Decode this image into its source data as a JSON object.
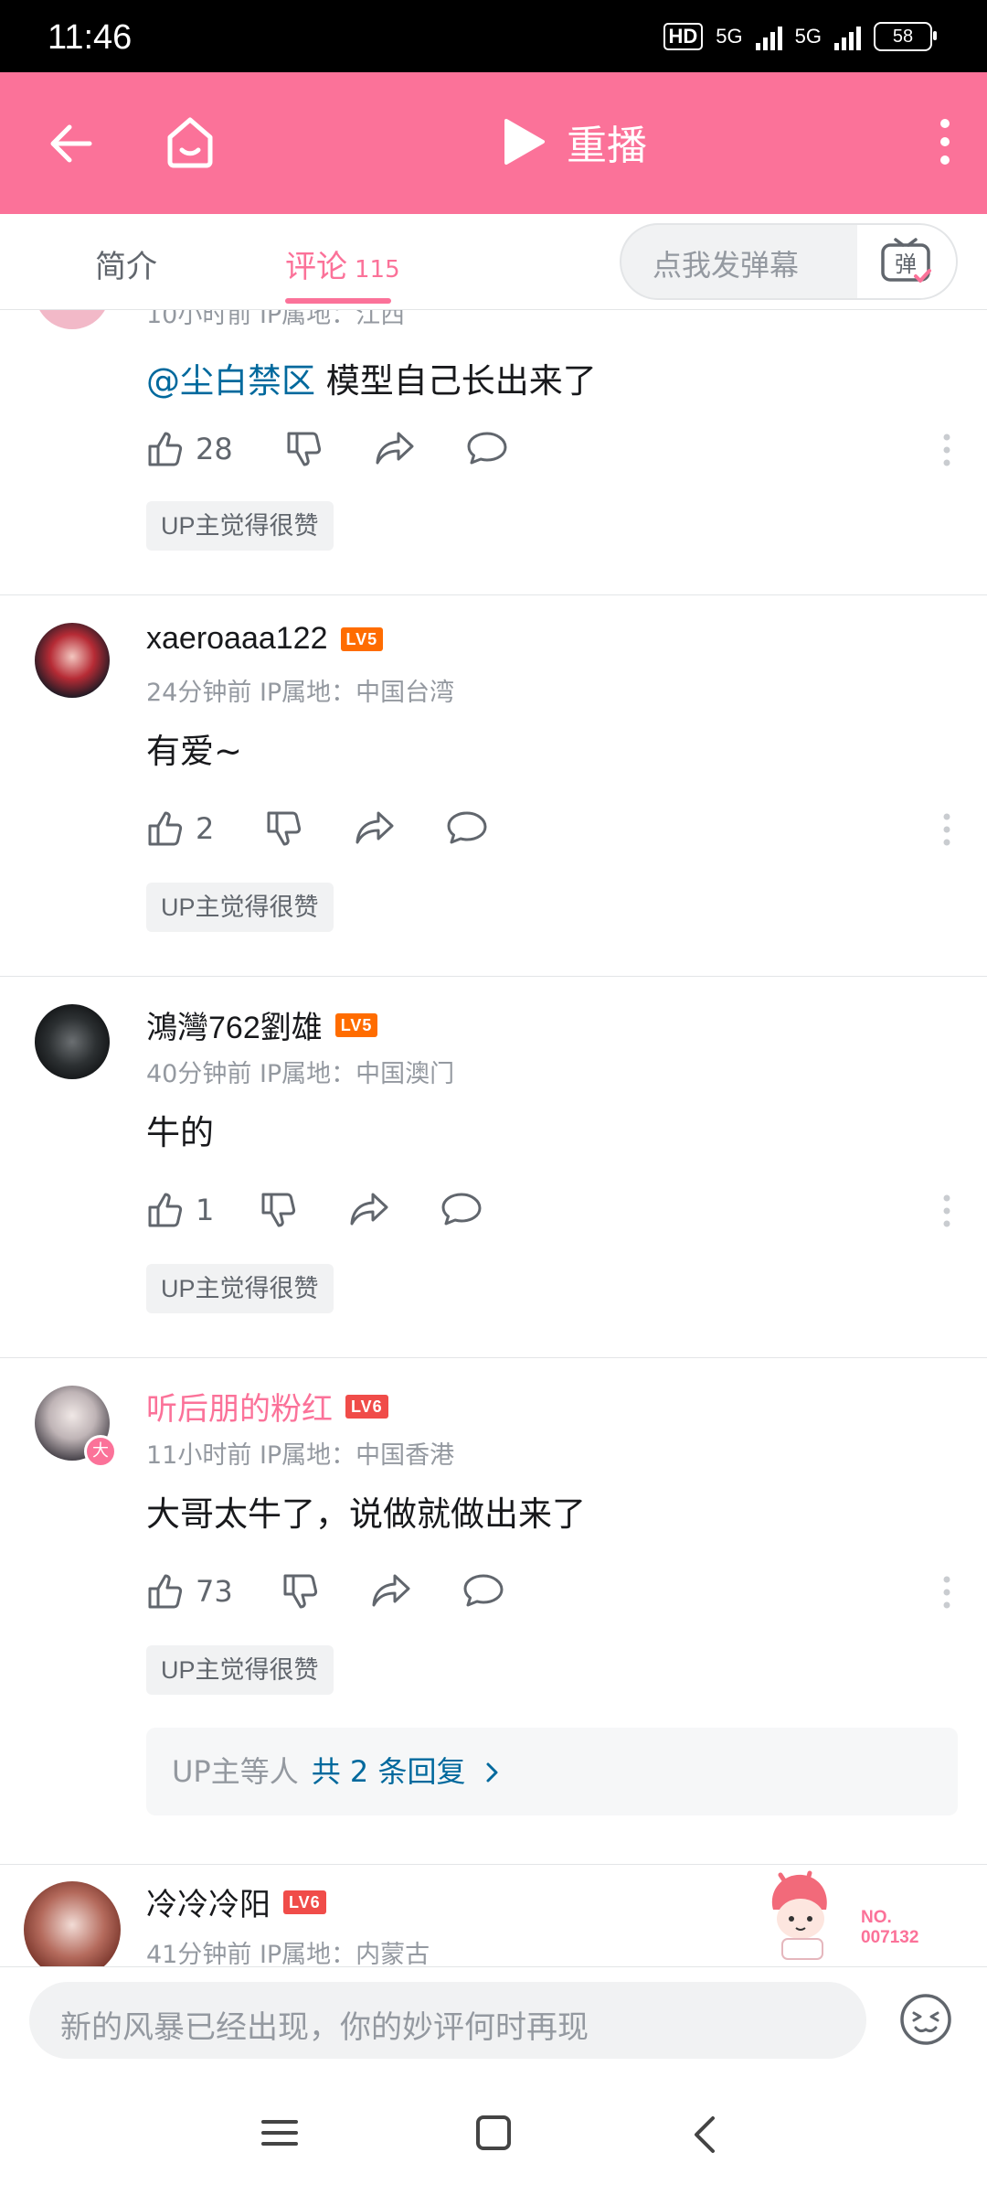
{
  "status_bar": {
    "time": "11:46",
    "hd": "HD",
    "net1": "5G",
    "net2": "5G",
    "battery": "58"
  },
  "topbar": {
    "replay_label": "重播"
  },
  "tabs": {
    "intro": "简介",
    "comments": "评论",
    "comments_count": "115",
    "danmu_placeholder": "点我发弹幕",
    "danmu_icon_char": "弹"
  },
  "comments": [
    {
      "meta": "10小时前 IP属地：江西",
      "mention": "@尘白禁区",
      "text": "模型自己长出来了",
      "likes": "28",
      "up_badge": "UP主觉得很赞"
    },
    {
      "username": "xaeroaaa122",
      "level": "LV5",
      "meta": "24分钟前 IP属地：中国台湾",
      "text": "有爱~",
      "likes": "2",
      "up_badge": "UP主觉得很赞"
    },
    {
      "username": "鴻灣762劉雄",
      "level": "LV5",
      "meta": "40分钟前 IP属地：中国澳门",
      "text": "牛的",
      "likes": "1",
      "up_badge": "UP主觉得很赞"
    },
    {
      "username": "听后朋的粉红",
      "level": "LV6",
      "vip_badge": "大",
      "meta": "11小时前 IP属地：中国香港",
      "text": "大哥太牛了，说做就做出来了",
      "likes": "73",
      "up_badge": "UP主觉得很赞",
      "replies_who": "UP主等人",
      "replies_link": "共 2 条回复"
    },
    {
      "username": "冷冷冷阳",
      "level": "LV6",
      "meta": "41分钟前 IP属地：内蒙古",
      "sticker_no": "NO.",
      "sticker_num": "007132"
    }
  ],
  "bottom": {
    "input_placeholder": "新的风暴已经出现，你的妙评何时再现"
  },
  "colors": {
    "accent": "#fb7299",
    "link": "#00699d",
    "lv5": "#ff6c00",
    "lv6": "#f04c49"
  }
}
